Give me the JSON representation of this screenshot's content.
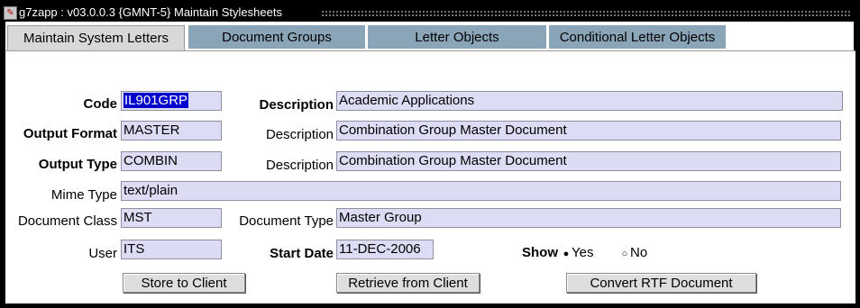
{
  "window": {
    "title": "g7zapp : v03.0.0.3  {GMNT-5} Maintain Stylesheets",
    "icon": "app-icon"
  },
  "tabs": [
    {
      "label": "Maintain System Letters",
      "active": true
    },
    {
      "label": "Document Groups",
      "active": false
    },
    {
      "label": "Letter Objects",
      "active": false
    },
    {
      "label": "Conditional Letter Objects",
      "active": false
    }
  ],
  "form": {
    "code_label": "Code",
    "code_value": "IL901GRP",
    "description_label_1": "Description",
    "description_value_1": "Academic Applications",
    "output_format_label": "Output Format",
    "output_format_value": "MASTER",
    "description_label_2": "Description",
    "description_value_2": "Combination Group Master Document",
    "output_type_label": "Output Type",
    "output_type_value": "COMBIN",
    "description_label_3": "Description",
    "description_value_3": "Combination Group Master Document",
    "mime_type_label": "Mime Type",
    "mime_type_value": "text/plain",
    "document_class_label": "Document Class",
    "document_class_value": "MST",
    "document_type_label": "Document Type",
    "document_type_value": "Master Group",
    "user_label": "User",
    "user_value": "ITS",
    "start_date_label": "Start Date",
    "start_date_value": "11-DEC-2006",
    "show_label": "Show",
    "show_yes": "Yes",
    "show_no": "No",
    "show_selected": "Yes"
  },
  "buttons": {
    "store": "Store to Client",
    "retrieve": "Retrieve from Client",
    "convert": "Convert RTF Document"
  },
  "colors": {
    "field_bg": "#dcdcf4",
    "selection": "#0000cc",
    "tab_inactive": "#8aa4b8"
  }
}
